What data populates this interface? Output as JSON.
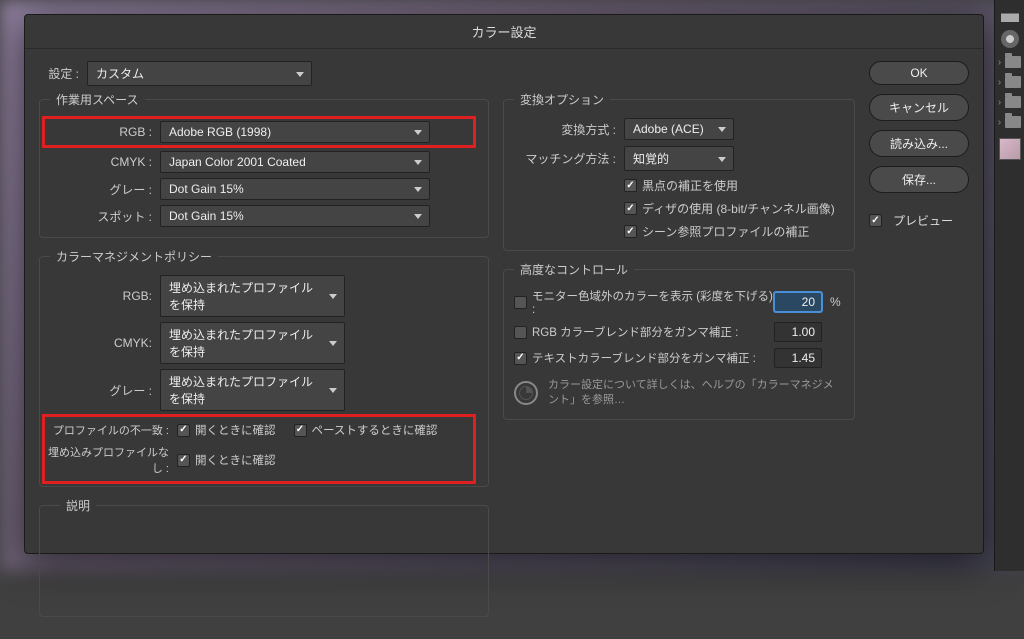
{
  "dialog": {
    "title": "カラー設定",
    "settings_label": "設定 :",
    "settings_value": "カスタム"
  },
  "buttons": {
    "ok": "OK",
    "cancel": "キャンセル",
    "load": "読み込み...",
    "save": "保存...",
    "preview": "プレビュー"
  },
  "workspace": {
    "legend": "作業用スペース",
    "rgb_label": "RGB :",
    "rgb_value": "Adobe RGB (1998)",
    "cmyk_label": "CMYK :",
    "cmyk_value": "Japan Color 2001 Coated",
    "gray_label": "グレー :",
    "gray_value": "Dot Gain 15%",
    "spot_label": "スポット :",
    "spot_value": "Dot Gain 15%"
  },
  "policy": {
    "legend": "カラーマネジメントポリシー",
    "rgb_label": "RGB:",
    "rgb_value": "埋め込まれたプロファイルを保持",
    "cmyk_label": "CMYK:",
    "cmyk_value": "埋め込まれたプロファイルを保持",
    "gray_label": "グレー :",
    "gray_value": "埋め込まれたプロファイルを保持",
    "mismatch_label": "プロファイルの不一致 :",
    "missing_label": "埋め込みプロファイルなし :",
    "open_check": "開くときに確認",
    "paste_check": "ペーストするときに確認"
  },
  "conversion": {
    "legend": "変換オプション",
    "engine_label": "変換方式 :",
    "engine_value": "Adobe (ACE)",
    "intent_label": "マッチング方法 :",
    "intent_value": "知覚的",
    "blackpoint": "黒点の補正を使用",
    "dither": "ディザの使用 (8-bit/チャンネル画像)",
    "scene": "シーン参照プロファイルの補正"
  },
  "advanced": {
    "legend": "高度なコントロール",
    "desat_label": "モニター色域外のカラーを表示 (彩度を下げる) :",
    "desat_value": "20",
    "desat_unit": "%",
    "rgb_gamma_label": "RGB カラーブレンド部分をガンマ補正 :",
    "rgb_gamma_value": "1.00",
    "text_gamma_label": "テキストカラーブレンド部分をガンマ補正 :",
    "text_gamma_value": "1.45",
    "help": "カラー設定について詳しくは、ヘルプの「カラーマネジメント」を参照…"
  },
  "description": {
    "legend": "説明"
  }
}
